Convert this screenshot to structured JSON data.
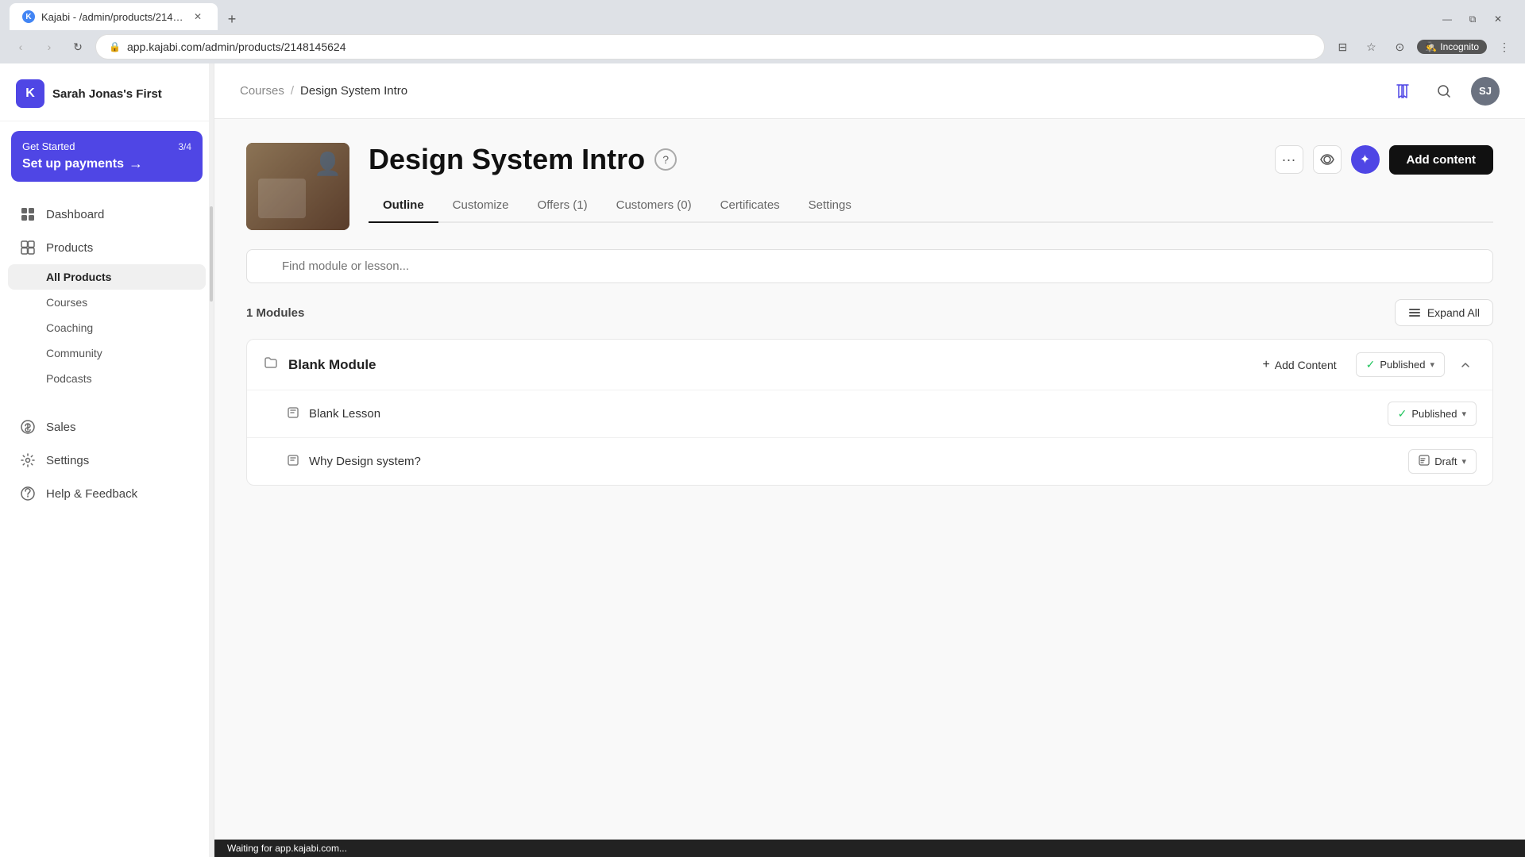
{
  "browser": {
    "tab_title": "Kajabi - /admin/products/21481...",
    "tab_favicon": "K",
    "url": "app.kajabi.com/admin/products/2148145624",
    "incognito_label": "Incognito"
  },
  "sidebar": {
    "logo_text": "Sarah Jonas's First",
    "logo_abbr": "K",
    "promo": {
      "label": "Get Started",
      "badge": "3/4",
      "text": "Set up payments",
      "arrow": "→"
    },
    "nav_items": [
      {
        "id": "dashboard",
        "label": "Dashboard",
        "icon": "⊞"
      },
      {
        "id": "products",
        "label": "Products",
        "icon": "◈"
      }
    ],
    "products_sub": [
      {
        "id": "all-products",
        "label": "All Products",
        "active": true
      },
      {
        "id": "courses",
        "label": "Courses"
      },
      {
        "id": "coaching",
        "label": "Coaching"
      },
      {
        "id": "community",
        "label": "Community"
      },
      {
        "id": "podcasts",
        "label": "Podcasts"
      }
    ],
    "nav_bottom": [
      {
        "id": "sales",
        "label": "Sales",
        "icon": "◎"
      },
      {
        "id": "settings",
        "label": "Settings",
        "icon": "⚙"
      },
      {
        "id": "help",
        "label": "Help & Feedback",
        "icon": "?"
      }
    ]
  },
  "breadcrumb": {
    "parent": "Courses",
    "separator": "/",
    "current": "Design System Intro"
  },
  "header": {
    "book_icon": "📖",
    "search_icon": "🔍",
    "avatar": "SJ"
  },
  "course": {
    "title": "Design System Intro",
    "help_icon": "?",
    "more_icon": "...",
    "view_icon": "👁",
    "ai_icon": "✦",
    "add_content_btn": "Add content",
    "tabs": [
      {
        "id": "outline",
        "label": "Outline",
        "active": true
      },
      {
        "id": "customize",
        "label": "Customize"
      },
      {
        "id": "offers",
        "label": "Offers (1)"
      },
      {
        "id": "customers",
        "label": "Customers (0)"
      },
      {
        "id": "certificates",
        "label": "Certificates"
      },
      {
        "id": "settings",
        "label": "Settings"
      }
    ]
  },
  "outline": {
    "search_placeholder": "Find module or lesson...",
    "modules_count": "1",
    "modules_label": "Modules",
    "expand_all_label": "Expand All",
    "expand_icon": "≡",
    "modules": [
      {
        "id": "blank-module",
        "title": "Blank Module",
        "folder_icon": "📁",
        "add_content_label": "Add Content",
        "status": "Published",
        "status_color": "#22c55e",
        "lessons": [
          {
            "id": "blank-lesson",
            "title": "Blank Lesson",
            "icon": "📄",
            "status": "Published",
            "status_type": "published"
          },
          {
            "id": "why-design-system",
            "title": "Why Design system?",
            "icon": "📄",
            "status": "Draft",
            "status_type": "draft"
          }
        ]
      }
    ]
  },
  "status_bar": {
    "text": "Waiting for app.kajabi.com..."
  }
}
